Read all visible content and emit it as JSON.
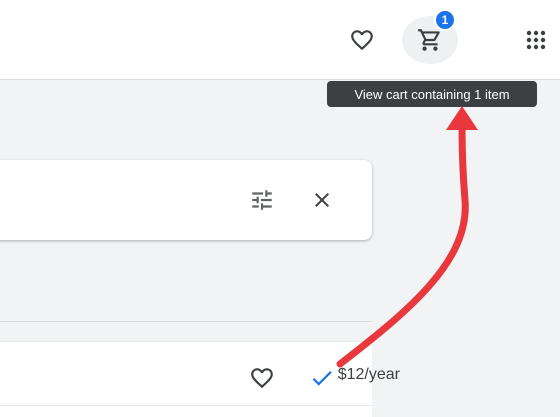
{
  "header": {
    "favorites_icon": "heart-outline-icon",
    "cart_icon": "shopping-cart-icon",
    "apps_icon": "apps-grid-icon",
    "cart_count": "1",
    "cart_tooltip": "View cart containing 1 item"
  },
  "filter_bar": {
    "tune_icon": "tune-icon",
    "close_icon": "close-icon"
  },
  "results": {
    "items": [
      {
        "price": "$12/year",
        "favorite_icon": "heart-outline-icon",
        "selected_icon": "check-icon"
      }
    ]
  },
  "colors": {
    "accent": "#1a73e8",
    "tooltip_bg": "#3c4043",
    "annotation_arrow": "#e8383d",
    "page_bg": "#f1f3f4"
  }
}
